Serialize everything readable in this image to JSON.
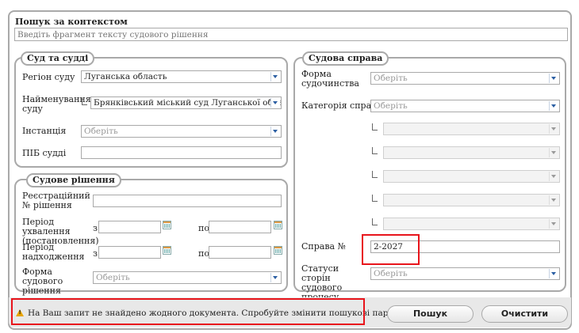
{
  "context_search": {
    "title": "Пошук за контекстом",
    "placeholder": "Введіть фрагмент тексту судового рішення"
  },
  "court_group": {
    "legend": "Суд та судді",
    "region_label": "Регіон суду",
    "region_value": "Луганська область",
    "court_name_label": "Найменування суду",
    "court_name_value": "Брянківський міський суд Луганської області",
    "instance_label": "Інстанція",
    "instance_value": "Оберіть",
    "judge_label": "ПІБ судді",
    "judge_value": ""
  },
  "decision_group": {
    "legend": "Судове рішення",
    "reg_number_label": "Реєстраційний № рішення",
    "adoption_label": "Період ухвалення (постановлення)",
    "receipt_label": "Період надходження",
    "from_label": "з",
    "to_label": "по",
    "form_label": "Форма судового рішення",
    "form_value": "Оберіть"
  },
  "case_group": {
    "legend": "Судова справа",
    "proceeding_form_label": "Форма судочинства",
    "proceeding_form_value": "Оберіть",
    "category_label": "Категорія справи",
    "category_value": "Оберіть",
    "case_number_label": "Справа №",
    "case_number_value": "2-2027",
    "party_status_label": "Статуси сторін судового процесу",
    "party_status_value": "Оберіть"
  },
  "footer": {
    "message": "На Ваш запит не знайдено жодного документа. Спробуйте змінити пошукові параметри.",
    "search_button": "Пошук",
    "clear_button": "Очистити"
  },
  "colors": {
    "highlight": "#e8141b",
    "border": "#a9a9a9",
    "warning": "#e8a400"
  }
}
